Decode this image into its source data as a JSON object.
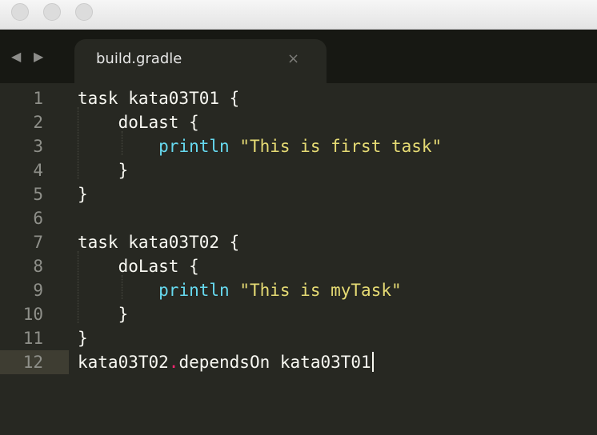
{
  "window": {
    "buttons": [
      "close",
      "minimize",
      "zoom"
    ]
  },
  "tabs": {
    "nav_back": "◀",
    "nav_forward": "▶",
    "active_label": "build.gradle",
    "close_glyph": "×"
  },
  "editor": {
    "line_numbers": [
      "1",
      "2",
      "3",
      "4",
      "5",
      "6",
      "7",
      "8",
      "9",
      "10",
      "11",
      "12"
    ],
    "lines": [
      {
        "t1": "task kata03T01 {"
      },
      {
        "indent": "    ",
        "t1": "doLast {"
      },
      {
        "indent": "        ",
        "kw": "println",
        "sp": " ",
        "str": "\"This is first task\""
      },
      {
        "indent": "    ",
        "t1": "}"
      },
      {
        "t1": "}"
      },
      {
        "t1": ""
      },
      {
        "t1": "task kata03T02 {"
      },
      {
        "indent": "    ",
        "t1": "doLast {"
      },
      {
        "indent": "        ",
        "kw": "println",
        "sp": " ",
        "str": "\"This is myTask\""
      },
      {
        "indent": "    ",
        "t1": "}"
      },
      {
        "t1": "}"
      },
      {
        "t1": "kata03T02",
        "op": ".",
        "t2": "dependsOn kata03T01"
      }
    ],
    "active_line": "12"
  },
  "colors": {
    "background": "#272822",
    "keyword": "#66d9ef",
    "string": "#e6db74",
    "operator": "#f92672"
  }
}
